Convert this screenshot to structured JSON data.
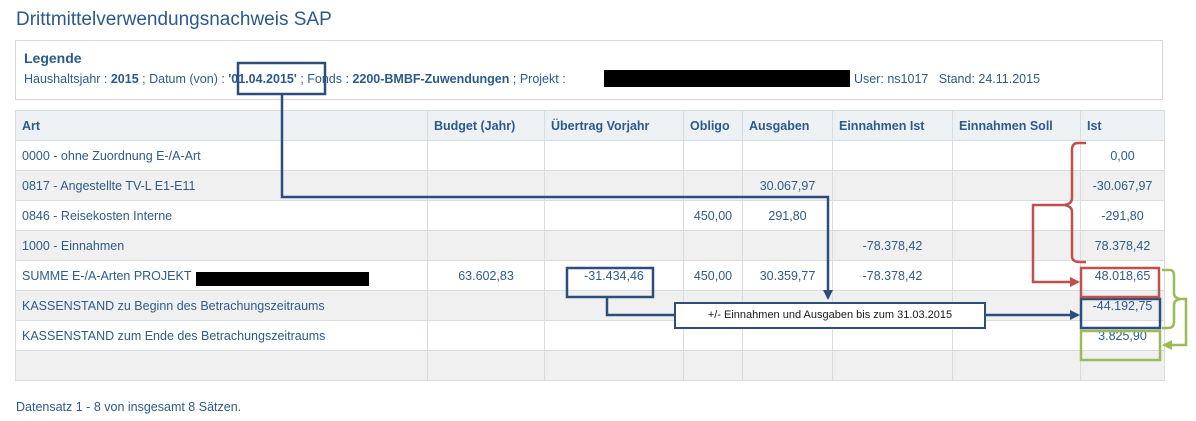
{
  "page": {
    "title": "Drittmittelverwendungsnachweis SAP"
  },
  "legend": {
    "title": "Legende",
    "haushaltsjahr_label": "Haushaltsjahr :",
    "haushaltsjahr_value": "2015",
    "datum_label": "; Datum (von) :",
    "datum_value": "'01.04.2015'",
    "fonds_label": "; Fonds :",
    "fonds_value": "2200-BMBF-Zuwendungen",
    "projekt_label": "; Projekt :",
    "user_label": "User: ns1017",
    "stand_label": "Stand: 24.11.2015"
  },
  "table": {
    "headers": [
      "Art",
      "Budget (Jahr)",
      "Übertrag Vorjahr",
      "Obligo",
      "Ausgaben",
      "Einnahmen Ist",
      "Einnahmen Soll",
      "Ist"
    ],
    "rows": [
      [
        "0000 - ohne Zuordnung E-/A-Art",
        "",
        "",
        "",
        "",
        "",
        "",
        "0,00"
      ],
      [
        "0817 - Angestellte TV-L E1-E11",
        "",
        "",
        "",
        "30.067,97",
        "",
        "",
        "-30.067,97"
      ],
      [
        "0846 - Reisekosten Interne",
        "",
        "",
        "450,00",
        "291,80",
        "",
        "",
        "-291,80"
      ],
      [
        "1000 - Einnahmen",
        "",
        "",
        "",
        "",
        "-78.378,42",
        "",
        "78.378,42"
      ],
      [
        "SUMME E-/A-Arten PROJEKT",
        "63.602,83",
        "-31.434,46",
        "450,00",
        "30.359,77",
        "-78.378,42",
        "",
        "48.018,65"
      ],
      [
        "KASSENSTAND zu Beginn des Betrachungszeitraums",
        "",
        "",
        "",
        "",
        "",
        "",
        "-44.192,75"
      ],
      [
        "KASSENSTAND zum Ende des Betrachungszeitraums",
        "",
        "",
        "",
        "",
        "",
        "",
        "3.825,90"
      ],
      [
        "",
        "",
        "",
        "",
        "",
        "",
        "",
        ""
      ]
    ]
  },
  "annotation": {
    "callout_text": "+/- Einnahmen und Ausgaben bis zum 31.03.2015",
    "colors": {
      "blue": "#2d4e7c",
      "red": "#c0504d",
      "green": "#9bbb59"
    }
  },
  "footer": {
    "text": "Datensatz 1 - 8 von insgesamt 8 Sätzen."
  }
}
